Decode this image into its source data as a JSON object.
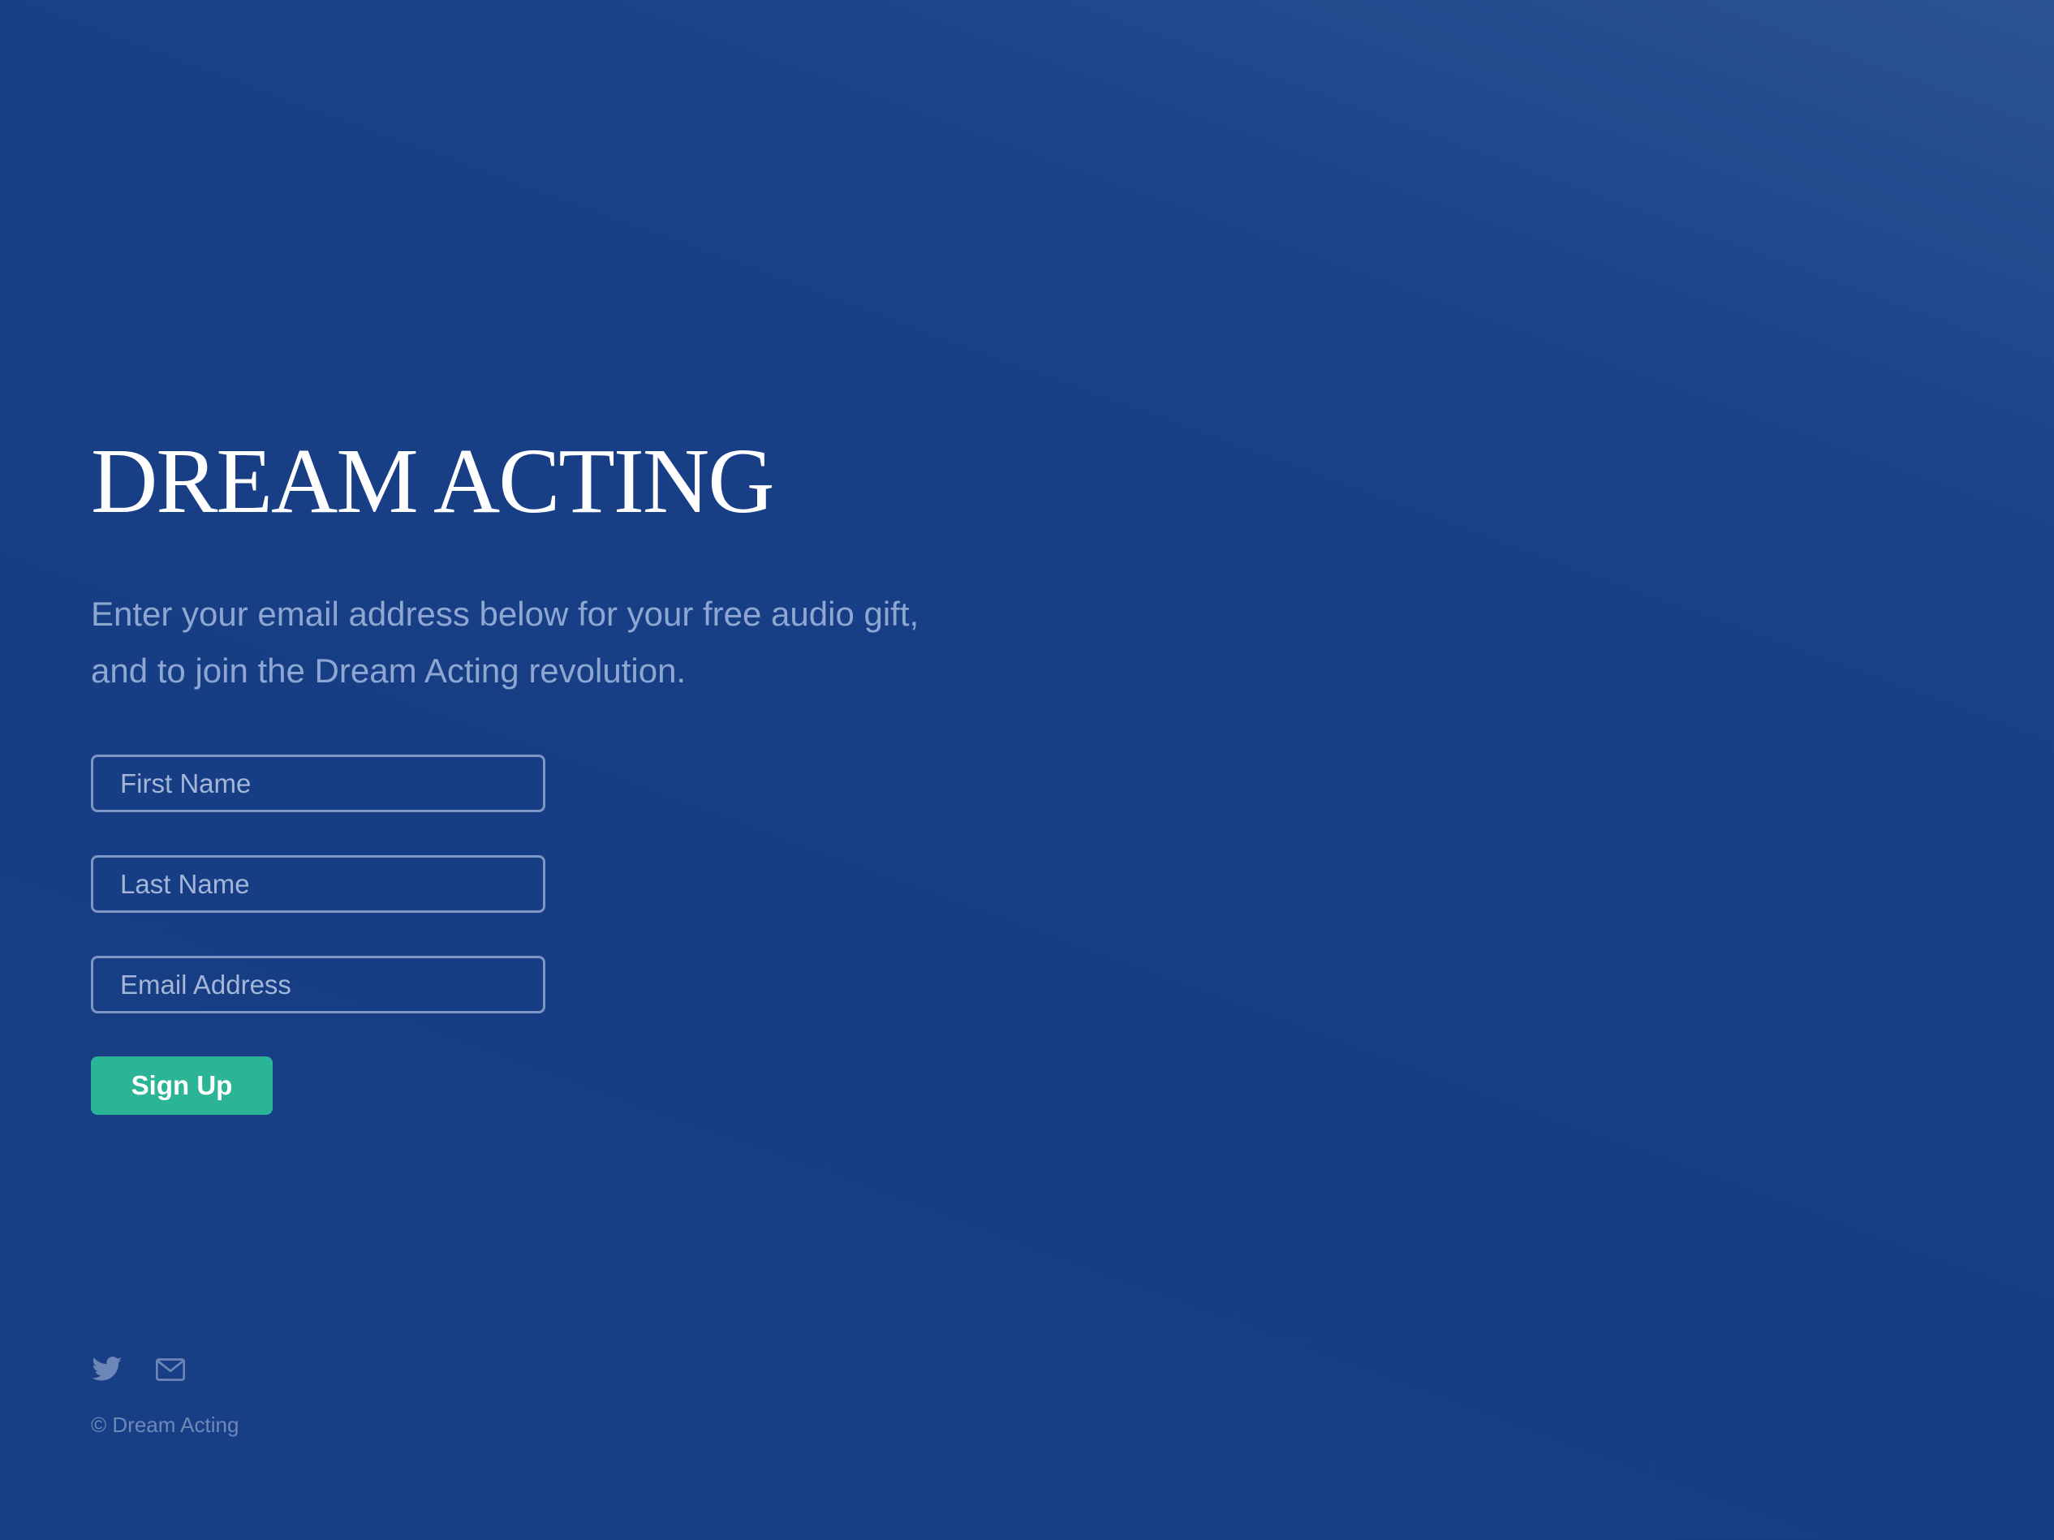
{
  "brand": {
    "title": "DREAM ACTING"
  },
  "intro": {
    "line1": "Enter your email address below for your free audio gift,",
    "line2": "and to join the Dream Acting revolution."
  },
  "form": {
    "first_name": {
      "value": "",
      "placeholder": "First Name"
    },
    "last_name": {
      "value": "",
      "placeholder": "Last Name"
    },
    "email": {
      "value": "",
      "placeholder": "Email Address"
    },
    "submit_label": "Sign Up"
  },
  "footer": {
    "social": [
      {
        "icon": "twitter-icon"
      },
      {
        "icon": "mail-icon"
      }
    ],
    "copyright": "© Dream Acting"
  },
  "colors": {
    "background": "#1a4088",
    "accent": "#2bb596",
    "text_muted": "#8ea7d2",
    "field_border": "#7d97c6"
  }
}
